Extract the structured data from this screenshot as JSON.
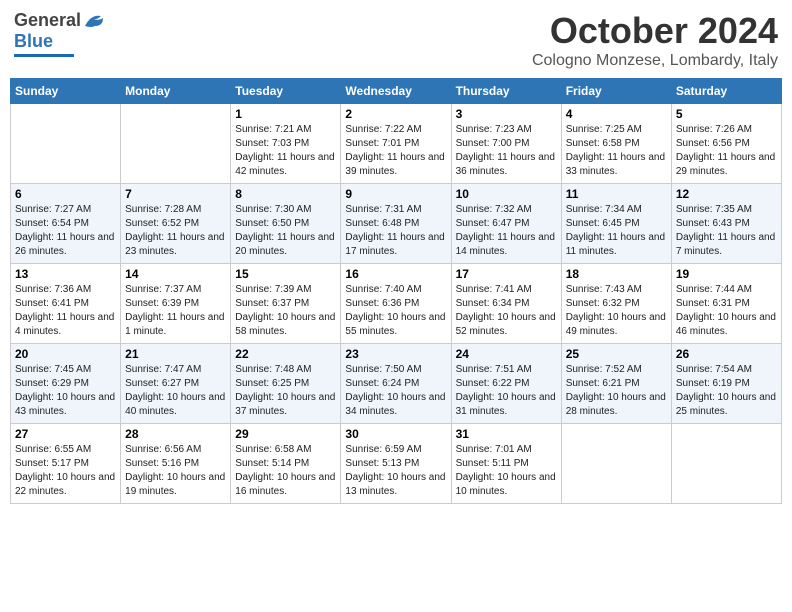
{
  "header": {
    "logo_general": "General",
    "logo_blue": "Blue",
    "month_title": "October 2024",
    "subtitle": "Cologno Monzese, Lombardy, Italy"
  },
  "days_of_week": [
    "Sunday",
    "Monday",
    "Tuesday",
    "Wednesday",
    "Thursday",
    "Friday",
    "Saturday"
  ],
  "weeks": [
    [
      {
        "num": "",
        "info": ""
      },
      {
        "num": "",
        "info": ""
      },
      {
        "num": "1",
        "info": "Sunrise: 7:21 AM\nSunset: 7:03 PM\nDaylight: 11 hours and 42 minutes."
      },
      {
        "num": "2",
        "info": "Sunrise: 7:22 AM\nSunset: 7:01 PM\nDaylight: 11 hours and 39 minutes."
      },
      {
        "num": "3",
        "info": "Sunrise: 7:23 AM\nSunset: 7:00 PM\nDaylight: 11 hours and 36 minutes."
      },
      {
        "num": "4",
        "info": "Sunrise: 7:25 AM\nSunset: 6:58 PM\nDaylight: 11 hours and 33 minutes."
      },
      {
        "num": "5",
        "info": "Sunrise: 7:26 AM\nSunset: 6:56 PM\nDaylight: 11 hours and 29 minutes."
      }
    ],
    [
      {
        "num": "6",
        "info": "Sunrise: 7:27 AM\nSunset: 6:54 PM\nDaylight: 11 hours and 26 minutes."
      },
      {
        "num": "7",
        "info": "Sunrise: 7:28 AM\nSunset: 6:52 PM\nDaylight: 11 hours and 23 minutes."
      },
      {
        "num": "8",
        "info": "Sunrise: 7:30 AM\nSunset: 6:50 PM\nDaylight: 11 hours and 20 minutes."
      },
      {
        "num": "9",
        "info": "Sunrise: 7:31 AM\nSunset: 6:48 PM\nDaylight: 11 hours and 17 minutes."
      },
      {
        "num": "10",
        "info": "Sunrise: 7:32 AM\nSunset: 6:47 PM\nDaylight: 11 hours and 14 minutes."
      },
      {
        "num": "11",
        "info": "Sunrise: 7:34 AM\nSunset: 6:45 PM\nDaylight: 11 hours and 11 minutes."
      },
      {
        "num": "12",
        "info": "Sunrise: 7:35 AM\nSunset: 6:43 PM\nDaylight: 11 hours and 7 minutes."
      }
    ],
    [
      {
        "num": "13",
        "info": "Sunrise: 7:36 AM\nSunset: 6:41 PM\nDaylight: 11 hours and 4 minutes."
      },
      {
        "num": "14",
        "info": "Sunrise: 7:37 AM\nSunset: 6:39 PM\nDaylight: 11 hours and 1 minute."
      },
      {
        "num": "15",
        "info": "Sunrise: 7:39 AM\nSunset: 6:37 PM\nDaylight: 10 hours and 58 minutes."
      },
      {
        "num": "16",
        "info": "Sunrise: 7:40 AM\nSunset: 6:36 PM\nDaylight: 10 hours and 55 minutes."
      },
      {
        "num": "17",
        "info": "Sunrise: 7:41 AM\nSunset: 6:34 PM\nDaylight: 10 hours and 52 minutes."
      },
      {
        "num": "18",
        "info": "Sunrise: 7:43 AM\nSunset: 6:32 PM\nDaylight: 10 hours and 49 minutes."
      },
      {
        "num": "19",
        "info": "Sunrise: 7:44 AM\nSunset: 6:31 PM\nDaylight: 10 hours and 46 minutes."
      }
    ],
    [
      {
        "num": "20",
        "info": "Sunrise: 7:45 AM\nSunset: 6:29 PM\nDaylight: 10 hours and 43 minutes."
      },
      {
        "num": "21",
        "info": "Sunrise: 7:47 AM\nSunset: 6:27 PM\nDaylight: 10 hours and 40 minutes."
      },
      {
        "num": "22",
        "info": "Sunrise: 7:48 AM\nSunset: 6:25 PM\nDaylight: 10 hours and 37 minutes."
      },
      {
        "num": "23",
        "info": "Sunrise: 7:50 AM\nSunset: 6:24 PM\nDaylight: 10 hours and 34 minutes."
      },
      {
        "num": "24",
        "info": "Sunrise: 7:51 AM\nSunset: 6:22 PM\nDaylight: 10 hours and 31 minutes."
      },
      {
        "num": "25",
        "info": "Sunrise: 7:52 AM\nSunset: 6:21 PM\nDaylight: 10 hours and 28 minutes."
      },
      {
        "num": "26",
        "info": "Sunrise: 7:54 AM\nSunset: 6:19 PM\nDaylight: 10 hours and 25 minutes."
      }
    ],
    [
      {
        "num": "27",
        "info": "Sunrise: 6:55 AM\nSunset: 5:17 PM\nDaylight: 10 hours and 22 minutes."
      },
      {
        "num": "28",
        "info": "Sunrise: 6:56 AM\nSunset: 5:16 PM\nDaylight: 10 hours and 19 minutes."
      },
      {
        "num": "29",
        "info": "Sunrise: 6:58 AM\nSunset: 5:14 PM\nDaylight: 10 hours and 16 minutes."
      },
      {
        "num": "30",
        "info": "Sunrise: 6:59 AM\nSunset: 5:13 PM\nDaylight: 10 hours and 13 minutes."
      },
      {
        "num": "31",
        "info": "Sunrise: 7:01 AM\nSunset: 5:11 PM\nDaylight: 10 hours and 10 minutes."
      },
      {
        "num": "",
        "info": ""
      },
      {
        "num": "",
        "info": ""
      }
    ]
  ]
}
